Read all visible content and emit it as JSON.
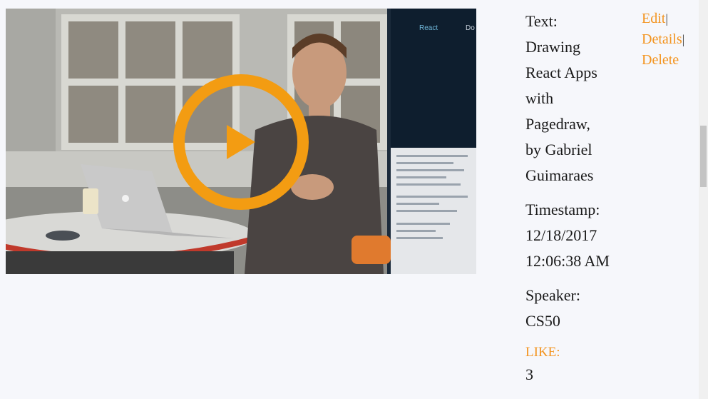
{
  "video": {
    "thumbnail_icon": "presentation-photo",
    "play_icon": "play-icon",
    "play_color": "#f39c12",
    "screen_app_label": "React",
    "screen_partial_label": "Do"
  },
  "entry": {
    "text_label": "Text:",
    "text_value": "Drawing\nReact Apps\nwith\nPagedraw,\nby Gabriel\nGuimaraes",
    "timestamp_label": "Timestamp:",
    "timestamp_value": "12/18/2017\n12:06:38 AM",
    "speaker_label": "Speaker:",
    "speaker_value": "CS50",
    "like_label": "LIKE:",
    "like_value": "3"
  },
  "actions": {
    "edit": "Edit",
    "details": "Details",
    "delete": "Delete",
    "separator": "|"
  },
  "colors": {
    "accent": "#f3941f",
    "background": "#f6f7fb"
  }
}
